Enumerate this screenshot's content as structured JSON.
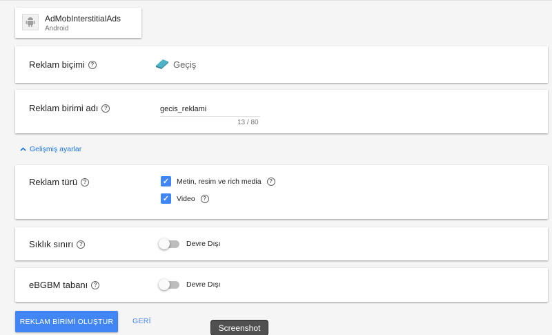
{
  "app": {
    "name": "AdMobInterstitialAds",
    "platform": "Android"
  },
  "ad_format": {
    "label": "Reklam biçimi",
    "value": "Geçiş"
  },
  "ad_unit_name": {
    "label": "Reklam birimi adı",
    "value": "gecis_reklami",
    "char_count": "13 / 80"
  },
  "advanced_settings": {
    "label": "Gelişmiş ayarlar"
  },
  "ad_type": {
    "label": "Reklam türü",
    "options": [
      {
        "label": "Metin, resim ve rich media",
        "checked": true
      },
      {
        "label": "Video",
        "checked": true
      }
    ]
  },
  "frequency_cap": {
    "label": "Sıklık sınırı",
    "state": "Devre Dışı"
  },
  "ecpm_floor": {
    "label": "eBGBM tabanı",
    "state": "Devre Dışı"
  },
  "actions": {
    "create_label": "REKLAM BİRİMİ OLUŞTUR",
    "back_label": "GERİ"
  },
  "tooltip": {
    "text": "Screenshot"
  },
  "colors": {
    "accent": "#4285f4",
    "link": "#1a73e8",
    "background": "#f5f5f5"
  }
}
